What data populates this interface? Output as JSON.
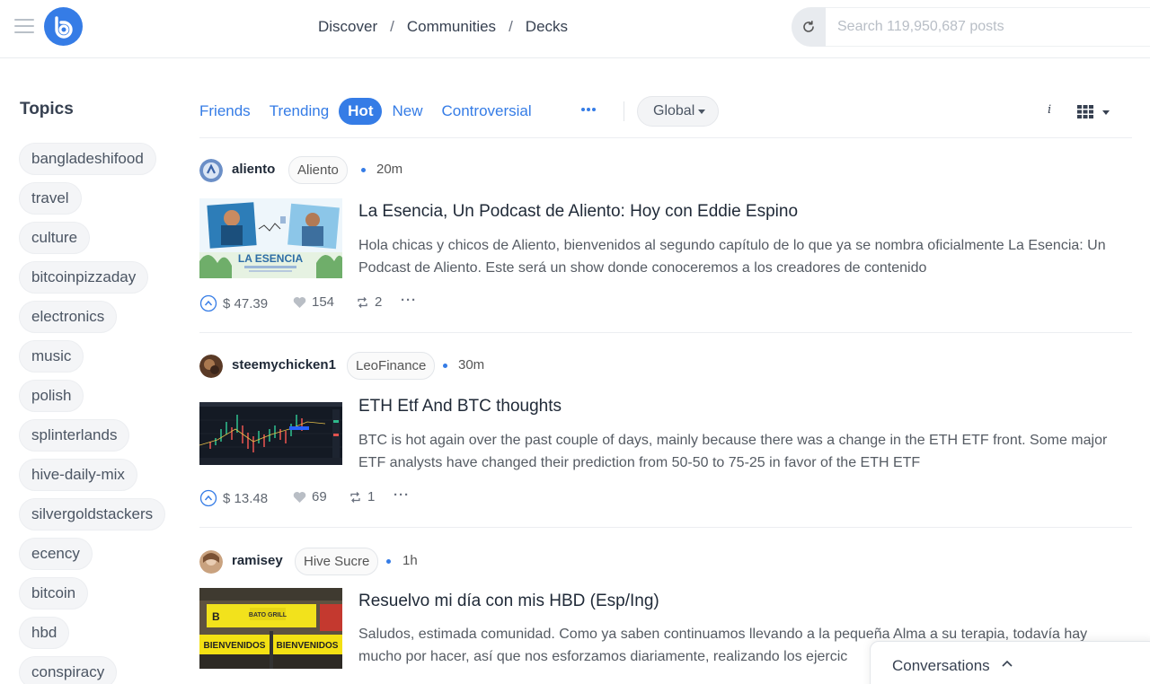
{
  "header": {
    "breadcrumb": [
      "Discover",
      "Communities",
      "Decks"
    ],
    "search_placeholder": "Search 119,950,687 posts"
  },
  "sidebar": {
    "title": "Topics",
    "topics": [
      "bangladeshifood",
      "travel",
      "culture",
      "bitcoinpizzaday",
      "electronics",
      "music",
      "polish",
      "splinterlands",
      "hive-daily-mix",
      "silvergoldstackers",
      "ecency",
      "bitcoin",
      "hbd",
      "conspiracy"
    ]
  },
  "tabs": {
    "items": [
      "Friends",
      "Trending",
      "Hot",
      "New",
      "Controversial"
    ],
    "active": "Hot",
    "filter": "Global",
    "info_label": "i"
  },
  "posts": [
    {
      "author": "aliento",
      "community": "Aliento",
      "time": "20m",
      "title": "La Esencia, Un Podcast de Aliento: Hoy con Eddie Espino",
      "summary": "Hola chicas y chicos de Aliento, bienvenidos al segundo capítulo de lo que ya se nombra oficialmente La Esencia: Un Podcast de Aliento. Este será un show donde conoceremos a los creadores de contenido",
      "payout": "$ 47.39",
      "votes": "154",
      "reblogs": "2",
      "thumb_text": "LA ESENCIA"
    },
    {
      "author": "steemychicken1",
      "community": "LeoFinance",
      "time": "30m",
      "title": "ETH Etf And BTC thoughts",
      "summary": "BTC is hot again over the past couple of days, mainly because there was a change in the ETH ETF front. Some major ETF analysts have changed their prediction from 50-50 to 75-25 in favor of the ETH ETF",
      "payout": "$ 13.48",
      "votes": "69",
      "reblogs": "1"
    },
    {
      "author": "ramisey",
      "community": "Hive Sucre",
      "time": "1h",
      "title": "Resuelvo mi día con mis HBD (Esp/Ing)",
      "summary": "Saludos, estimada comunidad. Como ya saben continuamos llevando a la pequeña Alma a su terapia, todavía hay mucho por hacer, así que nos esforzamos diariamente, realizando los ejercic",
      "thumb_text": [
        "BIENVENIDOS",
        "BIENVENIDOS"
      ]
    }
  ],
  "conversations": {
    "label": "Conversations"
  },
  "colors": {
    "accent": "#357ce6",
    "pill_bg": "#f4f5f7"
  }
}
